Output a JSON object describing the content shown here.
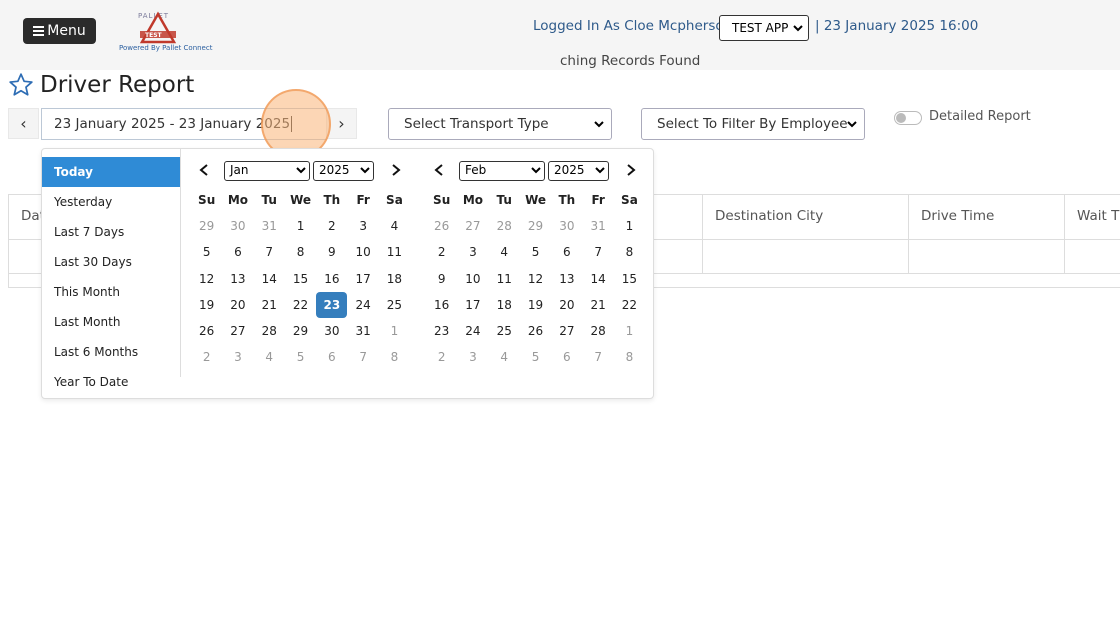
{
  "header": {
    "menu_label": "Menu",
    "logo_text": "PALLET CONNECT TEST",
    "logo_sub": "Powered By Pallet Connect",
    "logged_in": "Logged In As Cloe Mcpherson  |",
    "app_select": "TEST APP",
    "datetime": "| 23 January 2025 16:00"
  },
  "page": {
    "title": "Driver Report",
    "date_range": "23 January 2025 - 23 January 2025",
    "prev_label": "‹",
    "next_label": "›",
    "transport_type": "Select Transport Type",
    "employee_filter": "Select To Filter By Employee",
    "detailed_label": "Detailed Report"
  },
  "table": {
    "headers": [
      "Dat",
      "Destination City",
      "Drive Time",
      "Wait Ti"
    ],
    "empty": "ching Records Found"
  },
  "datepicker": {
    "ranges": [
      "Today",
      "Yesterday",
      "Last 7 Days",
      "Last 30 Days",
      "This Month",
      "Last Month",
      "Last 6 Months",
      "Year To Date"
    ],
    "active_range": "Today",
    "dow": [
      "Su",
      "Mo",
      "Tu",
      "We",
      "Th",
      "Fr",
      "Sa"
    ],
    "left": {
      "month": "Jan",
      "year": "2025",
      "days": [
        "29",
        "30",
        "31",
        "1",
        "2",
        "3",
        "4",
        "5",
        "6",
        "7",
        "8",
        "9",
        "10",
        "11",
        "12",
        "13",
        "14",
        "15",
        "16",
        "17",
        "18",
        "19",
        "20",
        "21",
        "22",
        "23",
        "24",
        "25",
        "26",
        "27",
        "28",
        "29",
        "30",
        "31",
        "1",
        "2",
        "3",
        "4",
        "5",
        "6",
        "7",
        "8"
      ],
      "off_indices": [
        0,
        1,
        2,
        34,
        35,
        36,
        37,
        38,
        39,
        40,
        41
      ],
      "selected_index": 25
    },
    "right": {
      "month": "Feb",
      "year": "2025",
      "days": [
        "26",
        "27",
        "28",
        "29",
        "30",
        "31",
        "1",
        "2",
        "3",
        "4",
        "5",
        "6",
        "7",
        "8",
        "9",
        "10",
        "11",
        "12",
        "13",
        "14",
        "15",
        "16",
        "17",
        "18",
        "19",
        "20",
        "21",
        "22",
        "23",
        "24",
        "25",
        "26",
        "27",
        "28",
        "1",
        "2",
        "3",
        "4",
        "5",
        "6",
        "7",
        "8"
      ],
      "off_indices": [
        0,
        1,
        2,
        3,
        4,
        5,
        34,
        35,
        36,
        37,
        38,
        39,
        40,
        41
      ],
      "selected_index": -1
    }
  },
  "colors": {
    "accent": "#2f8bd6",
    "selected": "#357ebd",
    "link": "#2e5a8a"
  },
  "icons": {
    "menu": "hamburger-icon",
    "star": "star-icon",
    "chevron": "chevron-down-icon"
  }
}
